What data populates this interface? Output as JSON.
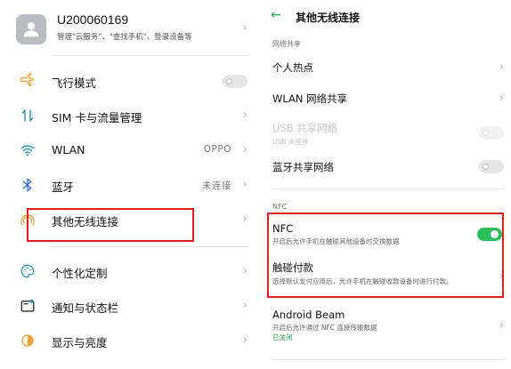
{
  "account": {
    "name": "U200060169",
    "description": "管理\"云服务\"、\"查找手机\"、登录设备等"
  },
  "settings": {
    "airplane": {
      "label": "飞行模式",
      "icon": "airplane-icon"
    },
    "sim": {
      "label": "SIM 卡与流量管理",
      "icon": "sim-data-icon"
    },
    "wlan": {
      "label": "WLAN",
      "value": "OPPO",
      "icon": "wifi-icon"
    },
    "bluetooth": {
      "label": "蓝牙",
      "value": "未连接",
      "icon": "bluetooth-icon"
    },
    "other_wireless": {
      "label": "其他无线连接",
      "icon": "wireless-connection-icon"
    },
    "personalization": {
      "label": "个性化定制",
      "icon": "palette-icon"
    },
    "notifications": {
      "label": "通知与状态栏",
      "icon": "notification-icon"
    },
    "display": {
      "label": "显示与亮度",
      "icon": "brightness-icon"
    }
  },
  "detail": {
    "title": "其他无线连接",
    "network_sharing_header": "网络共享",
    "hotspot": {
      "label": "个人热点"
    },
    "wlan_share": {
      "label": "WLAN 网络共享"
    },
    "usb_share": {
      "label": "USB 共享网络",
      "sub": "USB 未连接"
    },
    "bt_share": {
      "label": "蓝牙共享网络"
    },
    "nfc_header": "NFC",
    "nfc": {
      "label": "NFC",
      "sub": "开启后允许手机在触碰其他设备时交换数据"
    },
    "tap_pay": {
      "label": "触碰付款",
      "sub": "选择默认支付应用后，允许手机在触碰收款设备时进行付款。"
    },
    "beam": {
      "label": "Android Beam",
      "sub": "开启后允许通过 NFC 连接传输数据",
      "status": "已关闭"
    }
  },
  "colors": {
    "accent_green": "#2bbd5e",
    "highlight_red": "#e02020",
    "icon_orange": "#f0a23a",
    "icon_teal": "#1f8fa8",
    "icon_blue": "#2f6fd1"
  }
}
